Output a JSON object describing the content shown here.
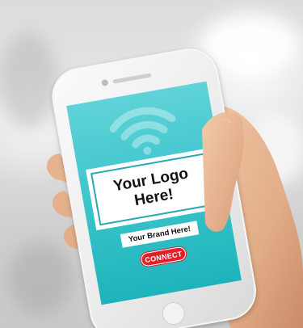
{
  "screen": {
    "logo_text": "Your Logo Here!",
    "brand_text": "Your Brand Here!",
    "connect_label": "CONNECT"
  },
  "icons": {
    "wifi": "wifi-icon"
  },
  "colors": {
    "screen_top": "#5fd3d8",
    "screen_bottom": "#1eb3bc",
    "connect": "#e2202a",
    "logo_border": "#2aa9b2"
  }
}
